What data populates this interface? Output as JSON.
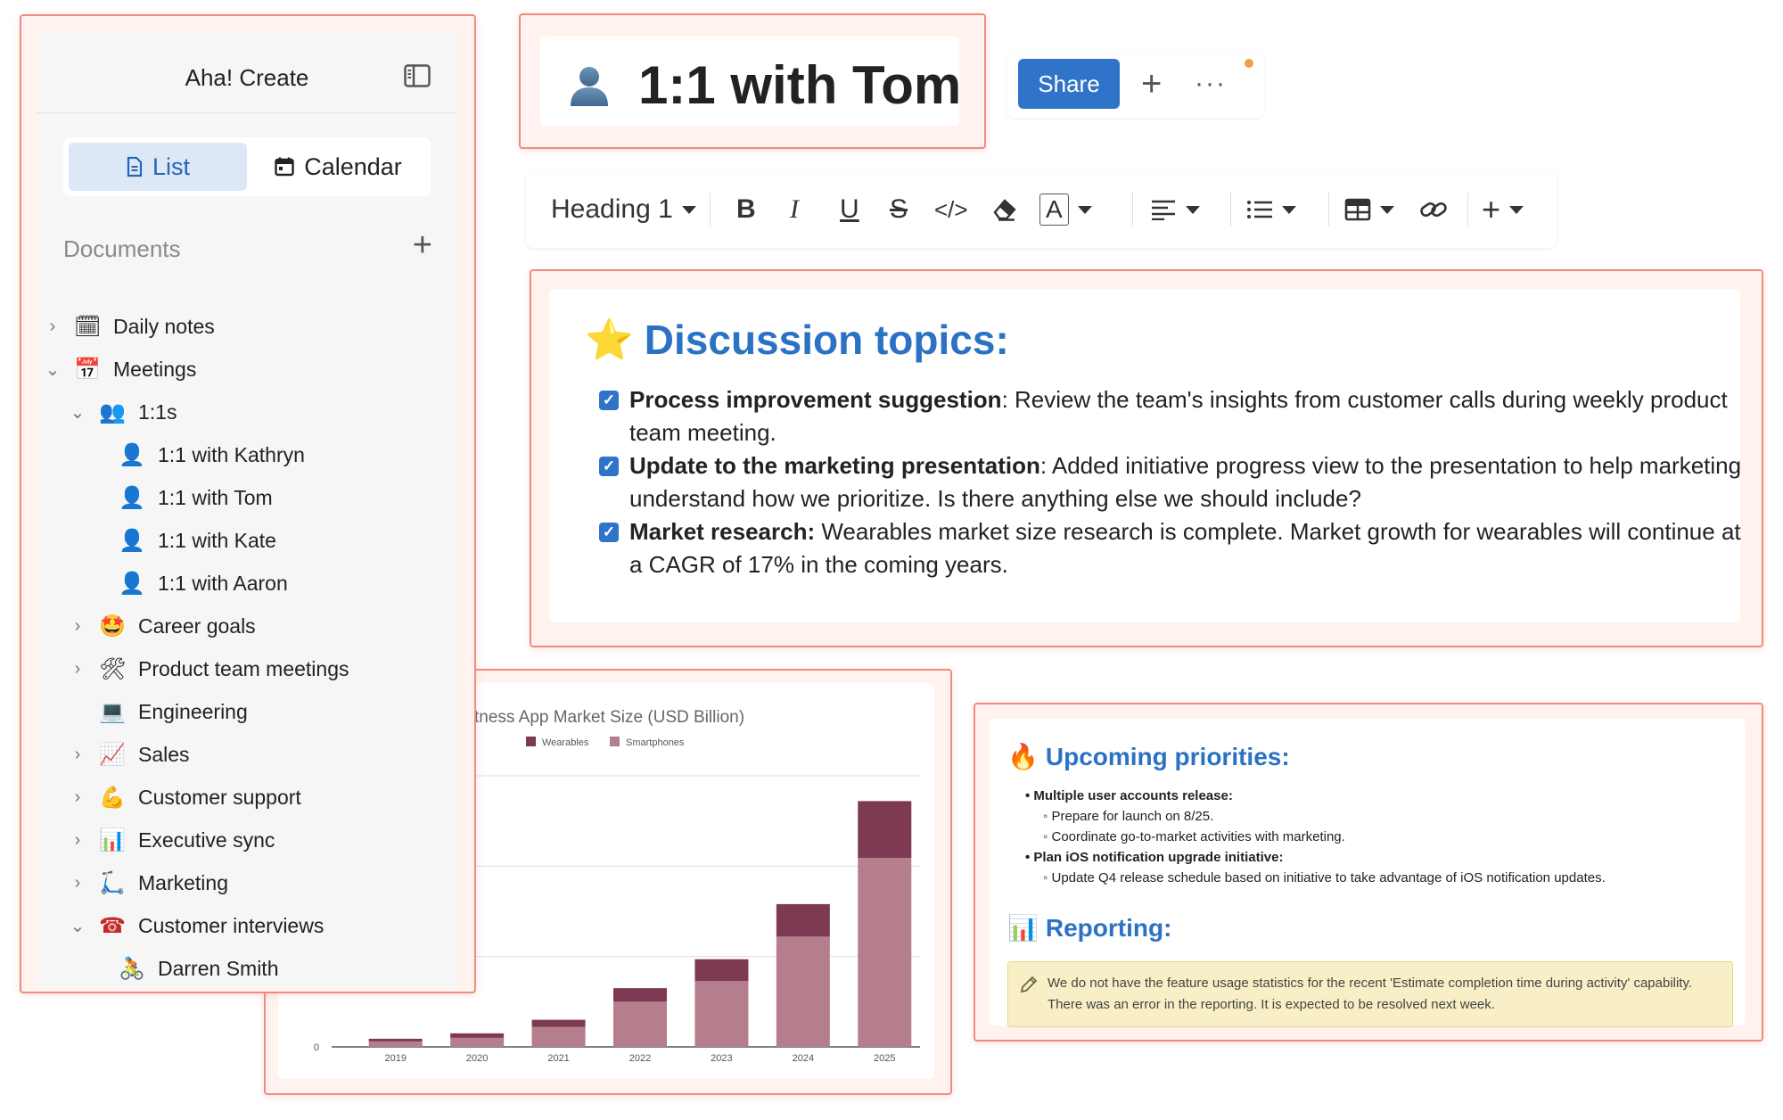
{
  "sidebar": {
    "app_title": "Aha! Create",
    "view_tabs": {
      "list": "List",
      "calendar": "Calendar"
    },
    "documents_label": "Documents",
    "add_symbol": "+",
    "items": [
      {
        "label": "Daily notes",
        "icon": "🗓",
        "chevron": "›"
      },
      {
        "label": "Meetings",
        "icon": "📅",
        "chevron": "⌄"
      },
      {
        "label": "1:1s",
        "icon": "👥",
        "chevron": "⌄"
      },
      {
        "label": "1:1 with Kathryn",
        "icon": "👤"
      },
      {
        "label": "1:1 with Tom",
        "icon": "👤"
      },
      {
        "label": "1:1 with Kate",
        "icon": "👤"
      },
      {
        "label": "1:1 with Aaron",
        "icon": "👤"
      },
      {
        "label": "Career goals",
        "icon": "🤩",
        "chevron": "›"
      },
      {
        "label": "Product team meetings",
        "icon": "🛠",
        "chevron": "›"
      },
      {
        "label": "Engineering",
        "icon": "💻"
      },
      {
        "label": "Sales",
        "icon": "📈",
        "chevron": "›"
      },
      {
        "label": "Customer support",
        "icon": "💪",
        "chevron": "›"
      },
      {
        "label": "Executive sync",
        "icon": "📊",
        "chevron": "›"
      },
      {
        "label": "Marketing",
        "icon": "🛴",
        "chevron": "›"
      },
      {
        "label": "Customer interviews",
        "icon": "☎",
        "chevron": "⌄"
      },
      {
        "label": "Darren Smith",
        "icon": "🚴"
      }
    ]
  },
  "document": {
    "title": "1:1 with Tom",
    "title_icon": "person-silhouette-icon"
  },
  "actions": {
    "share_label": "Share",
    "plus": "+",
    "more": "···",
    "notification_color": "#f0a040"
  },
  "toolbar": {
    "block_style": "Heading 1",
    "bold": "B",
    "italic": "I",
    "underline": "U",
    "strike": "S",
    "code": "</>",
    "text_color": "A",
    "insert": "+"
  },
  "discussion": {
    "heading": "Discussion topics:",
    "heading_emoji": "⭐",
    "tasks": [
      {
        "bold": "Process improvement suggestion",
        "text": ": Review the team's insights from customer calls during weekly product team meeting.",
        "checked": true
      },
      {
        "bold": "Update to the marketing presentation",
        "text": ": Added initiative progress view to the presentation to help marketing understand how we prioritize. Is there anything else we should include?",
        "checked": true
      },
      {
        "bold": "Market research:",
        "text": " Wearables market size research is complete. Market growth for wearables will continue at a CAGR of 17% in the coming years.",
        "checked": true
      }
    ]
  },
  "chart_data": {
    "type": "bar",
    "stacked": true,
    "title": "tness App Market Size (USD Billion)",
    "categories": [
      "2019",
      "2020",
      "2021",
      "2022",
      "2023",
      "2024",
      "2025"
    ],
    "series": [
      {
        "name": "Wearables",
        "color": "#7e3a52",
        "values": [
          0.3,
          0.5,
          0.8,
          1.5,
          2.4,
          3.6,
          6.3
        ]
      },
      {
        "name": "Smartphones",
        "color": "#b57e8c",
        "values": [
          0.6,
          1.0,
          2.2,
          5.0,
          7.3,
          12.2,
          20.9
        ]
      }
    ],
    "y_min_label": "0",
    "ylim": [
      0,
      30
    ],
    "grid": true,
    "legend": "top-center"
  },
  "priorities": {
    "heading": "Upcoming priorities:",
    "heading_emoji": "🔥",
    "items": [
      {
        "text": "Multiple user accounts release:",
        "sub": [
          "Prepare for launch on 8/25.",
          "Coordinate go-to-market activities with marketing."
        ]
      },
      {
        "text": "Plan iOS notification upgrade initiative:",
        "sub": [
          "Update Q4 release schedule based on initiative to take advantage of iOS notification updates."
        ]
      }
    ],
    "reporting_heading": "Reporting:",
    "reporting_emoji": "📊",
    "reporting_note": "We do not have the feature usage statistics for the recent 'Estimate completion time during activity' capability. There was an error in the reporting. It is expected to be resolved next week."
  }
}
